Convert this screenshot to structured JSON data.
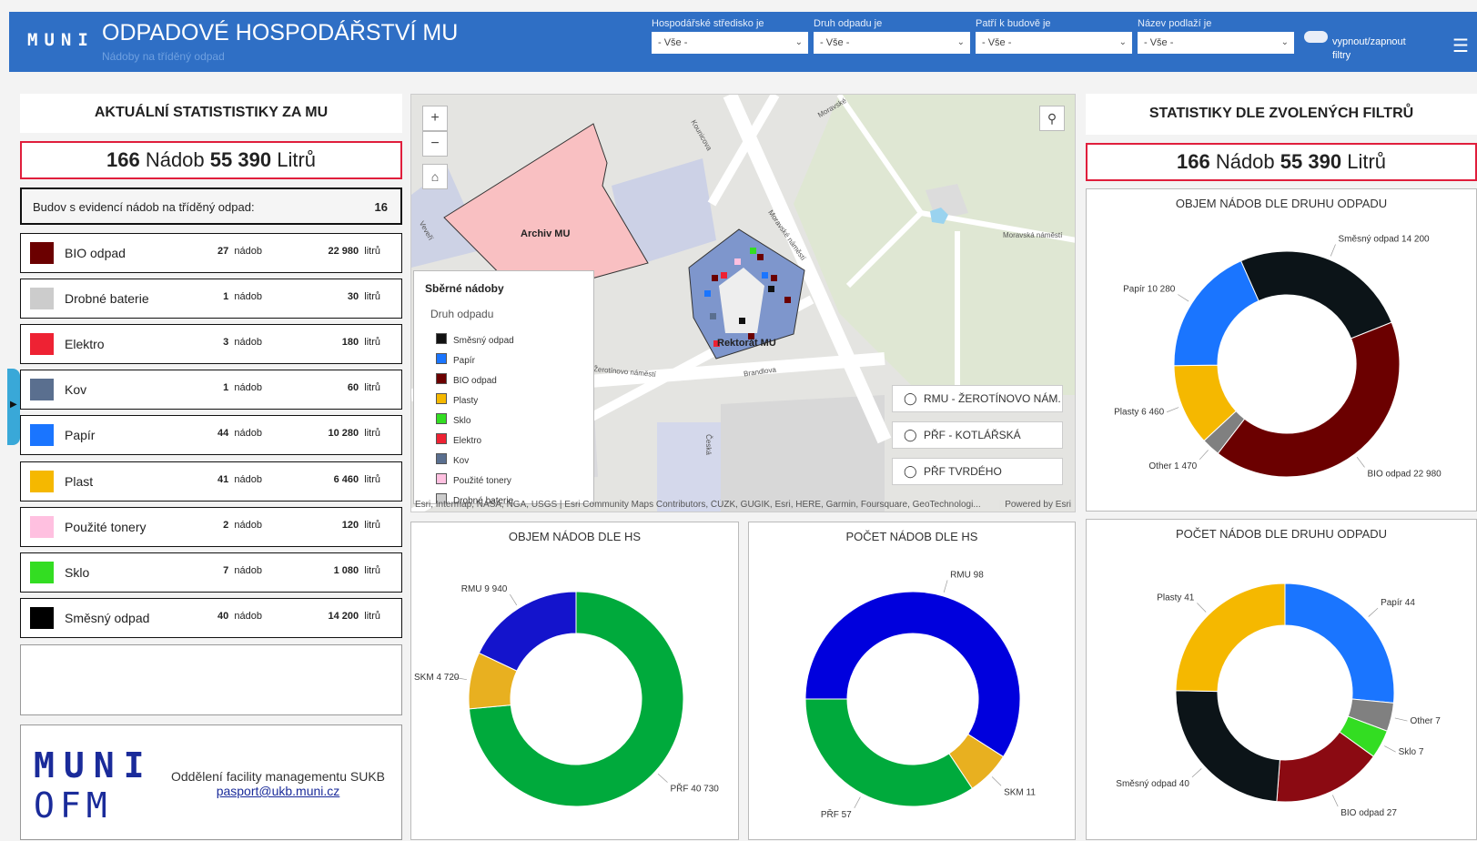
{
  "header": {
    "logo": "MUNI",
    "title": "ODPADOVÉ HOSPODÁŘSTVÍ MU",
    "subtitle": "Nádoby na tříděný odpad",
    "filters": [
      {
        "label": "Hospodářské středisko je",
        "value": "- Vše -"
      },
      {
        "label": "Druh odpadu je",
        "value": "- Vše -"
      },
      {
        "label": "Patří k budově je",
        "value": "- Vše -"
      },
      {
        "label": "Název podlaží je",
        "value": "- Vše -"
      }
    ],
    "toggle_label": "vypnout/zapnout filtry",
    "menu_icon": "hamburger-menu-icon"
  },
  "left": {
    "title": "AKTUÁLNÍ STATISTISTIKY ZA MU",
    "total_count": "166",
    "total_count_unit": "Nádob",
    "total_volume": "55 390",
    "total_volume_unit": "Litrů",
    "buildings_label": "Budov s evidencí nádob na tříděný odpad:",
    "buildings_value": "16",
    "rows": [
      {
        "name": "BIO odpad",
        "color": "#6b0000",
        "count": "27",
        "count_unit": "nádob",
        "volume": "22 980",
        "volume_unit": "litrů"
      },
      {
        "name": "Drobné baterie",
        "color": "#cccccc",
        "count": "1",
        "count_unit": "nádob",
        "volume": "30",
        "volume_unit": "litrů"
      },
      {
        "name": "Elektro",
        "color": "#ee2233",
        "count": "3",
        "count_unit": "nádob",
        "volume": "180",
        "volume_unit": "litrů"
      },
      {
        "name": "Kov",
        "color": "#5a6f8f",
        "count": "1",
        "count_unit": "nádob",
        "volume": "60",
        "volume_unit": "litrů"
      },
      {
        "name": "Papír",
        "color": "#1a75ff",
        "count": "44",
        "count_unit": "nádob",
        "volume": "10 280",
        "volume_unit": "litrů"
      },
      {
        "name": "Plast",
        "color": "#f5b800",
        "count": "41",
        "count_unit": "nádob",
        "volume": "6 460",
        "volume_unit": "litrů"
      },
      {
        "name": "Použité tonery",
        "color": "#ffc0e0",
        "count": "2",
        "count_unit": "nádob",
        "volume": "120",
        "volume_unit": "litrů"
      },
      {
        "name": "Sklo",
        "color": "#33dd22",
        "count": "7",
        "count_unit": "nádob",
        "volume": "1 080",
        "volume_unit": "litrů"
      },
      {
        "name": "Směsný odpad",
        "color": "#000000",
        "count": "40",
        "count_unit": "nádob",
        "volume": "14 200",
        "volume_unit": "litrů"
      }
    ],
    "footer": {
      "logo_line1": "MUNI",
      "logo_line2": "OFM",
      "department": "Oddělení facility managementu SUKB",
      "email": "pasport@ukb.muni.cz"
    }
  },
  "map": {
    "zoom_in": "+",
    "zoom_out": "−",
    "home_icon": "home-icon",
    "search_icon": "search-icon",
    "labels": {
      "archiv": "Archiv MU",
      "rektorat": "Rektorát MU",
      "streets": [
        "Moravské",
        "Kounicova",
        "Veveří",
        "Moravské náměstí",
        "Žerotínovo náměstí",
        "Brandlova",
        "Česká",
        "Moravská náměstí"
      ]
    },
    "legend": {
      "title": "Sběrné nádoby",
      "subtitle": "Druh odpadu",
      "items": [
        {
          "label": "Směsný odpad",
          "color": "#111111"
        },
        {
          "label": "Papír",
          "color": "#1a75ff"
        },
        {
          "label": "BIO odpad",
          "color": "#6b0000"
        },
        {
          "label": "Plasty",
          "color": "#f5b800"
        },
        {
          "label": "Sklo",
          "color": "#33dd22"
        },
        {
          "label": "Elektro",
          "color": "#ee2233"
        },
        {
          "label": "Kov",
          "color": "#5a6f8f"
        },
        {
          "label": "Použité tonery",
          "color": "#ffc0e0"
        },
        {
          "label": "Drobné baterie",
          "color": "#cccccc"
        }
      ]
    },
    "bookmarks": [
      "RMU - ŽEROTÍNOVO NÁM.",
      "PŘF - KOTLÁŘSKÁ",
      "PŘF TVRDÉHO"
    ],
    "attribution": "Esri, Intermap, NASA, NGA, USGS | Esri Community Maps Contributors, ČÚZK, GUGIK, Esri, HERE, Garmin, Foursquare, GeoTechnologi...",
    "powered_by": "Powered by Esri"
  },
  "right": {
    "title": "STATISTIKY DLE ZVOLENÝCH FILTRŮ",
    "total_count": "166",
    "total_count_unit": "Nádob",
    "total_volume": "55 390",
    "total_volume_unit": "Litrů"
  },
  "chart_data": [
    {
      "id": "objem-druh",
      "type": "pie",
      "donut": true,
      "title": "OBJEM NÁDOB DLE DRUHU ODPADU",
      "slices": [
        {
          "label": "Směsný odpad",
          "value": 14200,
          "text": "Směsný odpad 14 200",
          "color": "#0c1418"
        },
        {
          "label": "BIO odpad",
          "value": 22980,
          "text": "BIO odpad 22 980",
          "color": "#6b0000"
        },
        {
          "label": "Other",
          "value": 1470,
          "text": "Other 1 470",
          "color": "#808080"
        },
        {
          "label": "Plasty",
          "value": 6460,
          "text": "Plasty 6 460",
          "color": "#f5b800"
        },
        {
          "label": "Papír",
          "value": 10280,
          "text": "Papír 10 280",
          "color": "#1a75ff"
        }
      ]
    },
    {
      "id": "objem-hs",
      "type": "pie",
      "donut": true,
      "title": "OBJEM NÁDOB DLE HS",
      "slices": [
        {
          "label": "PŘF",
          "value": 40730,
          "text": "PŘF 40 730",
          "color": "#00aa3c"
        },
        {
          "label": "SKM",
          "value": 4720,
          "text": "SKM 4 720",
          "color": "#e8b020"
        },
        {
          "label": "RMU",
          "value": 9940,
          "text": "RMU 9 940",
          "color": "#1414cc"
        }
      ]
    },
    {
      "id": "pocet-hs",
      "type": "pie",
      "donut": true,
      "title": "POČET NÁDOB DLE HS",
      "slices": [
        {
          "label": "RMU",
          "value": 98,
          "text": "RMU 98",
          "color": "#0000dd"
        },
        {
          "label": "SKM",
          "value": 11,
          "text": "SKM 11",
          "color": "#e8b020"
        },
        {
          "label": "PŘF",
          "value": 57,
          "text": "PŘF 57",
          "color": "#00aa3c"
        }
      ]
    },
    {
      "id": "pocet-druh",
      "type": "pie",
      "donut": true,
      "title": "POČET NÁDOB DLE DRUHU ODPADU",
      "slices": [
        {
          "label": "Papír",
          "value": 44,
          "text": "Papír 44",
          "color": "#1a75ff"
        },
        {
          "label": "Other",
          "value": 7,
          "text": "Other 7",
          "color": "#808080"
        },
        {
          "label": "Sklo",
          "value": 7,
          "text": "Sklo 7",
          "color": "#33dd22"
        },
        {
          "label": "BIO odpad",
          "value": 27,
          "text": "BIO odpad 27",
          "color": "#8b0a12"
        },
        {
          "label": "Směsný odpad",
          "value": 40,
          "text": "Směsný odpad 40",
          "color": "#0c1418"
        },
        {
          "label": "Plasty",
          "value": 41,
          "text": "Plasty 41",
          "color": "#f5b800"
        }
      ]
    }
  ]
}
